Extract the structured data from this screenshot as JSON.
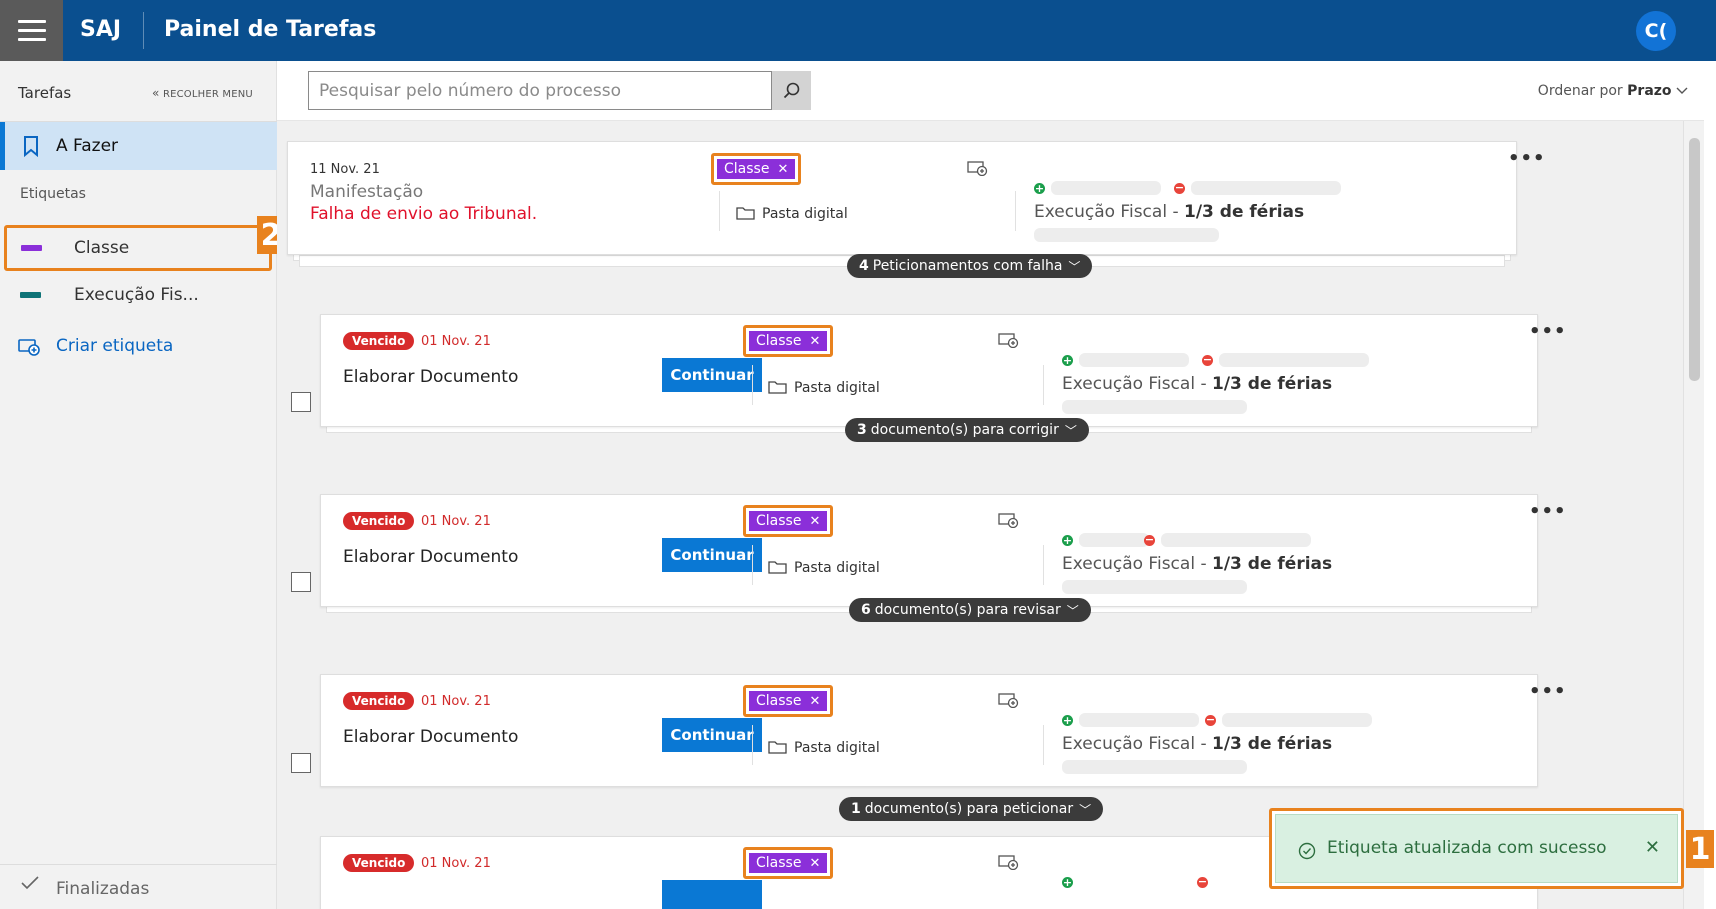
{
  "header": {
    "brand": "SAJ",
    "title": "Painel de Tarefas",
    "avatar_initials": "C("
  },
  "sidebar": {
    "tasks_label": "Tarefas",
    "collapse_label": "RECOLHER MENU",
    "todo_label": "A Fazer",
    "tags_heading": "Etiquetas",
    "tags": [
      {
        "label": "Classe",
        "color": "#8b2fd9"
      },
      {
        "label": "Execução Fis...",
        "color": "#0e7377"
      }
    ],
    "create_tag_label": "Criar etiqueta",
    "done_label": "Finalizadas"
  },
  "toolbar": {
    "search_placeholder": "Pesquisar pelo número do processo",
    "sort_prefix": "Ordenar por",
    "sort_value": "Prazo"
  },
  "cards": [
    {
      "date": "11 Nov. 21",
      "subtitle": "Manifestação",
      "error": "Falha de envio ao Tribunal.",
      "tag": "Classe",
      "folder": "Pasta digital",
      "class_prefix": "Execução Fiscal",
      "class_suffix": "1/3 de férias",
      "pill_count": "4",
      "pill_text": "Peticionamentos com falha"
    },
    {
      "badge": "Vencido",
      "date": "01 Nov. 21",
      "title": "Elaborar Documento",
      "button": "Continuar",
      "tag": "Classe",
      "folder": "Pasta digital",
      "class_prefix": "Execução Fiscal",
      "class_suffix": "1/3 de férias",
      "pill_count": "3",
      "pill_text": "documento(s) para corrigir"
    },
    {
      "badge": "Vencido",
      "date": "01 Nov. 21",
      "title": "Elaborar Documento",
      "button": "Continuar",
      "tag": "Classe",
      "folder": "Pasta digital",
      "class_prefix": "Execução Fiscal",
      "class_suffix": "1/3 de férias",
      "pill_count": "6",
      "pill_text": "documento(s) para revisar"
    },
    {
      "badge": "Vencido",
      "date": "01 Nov. 21",
      "title": "Elaborar Documento",
      "button": "Continuar",
      "tag": "Classe",
      "folder": "Pasta digital",
      "class_prefix": "Execução Fiscal",
      "class_suffix": "1/3 de férias",
      "pill_count": "1",
      "pill_text": "documento(s) para peticionar"
    },
    {
      "badge": "Vencido",
      "date": "01 Nov. 21",
      "tag": "Classe"
    }
  ],
  "toast": {
    "message": "Etiqueta atualizada com sucesso"
  },
  "annotations": {
    "one": "1",
    "two": "2"
  },
  "colors": {
    "header": "#0a4f8f",
    "accent": "#0a78d4",
    "tag": "#8b2fd9",
    "highlight": "#e8821e",
    "overdue": "#d72b2b",
    "success_bg": "#d9f0e1"
  }
}
